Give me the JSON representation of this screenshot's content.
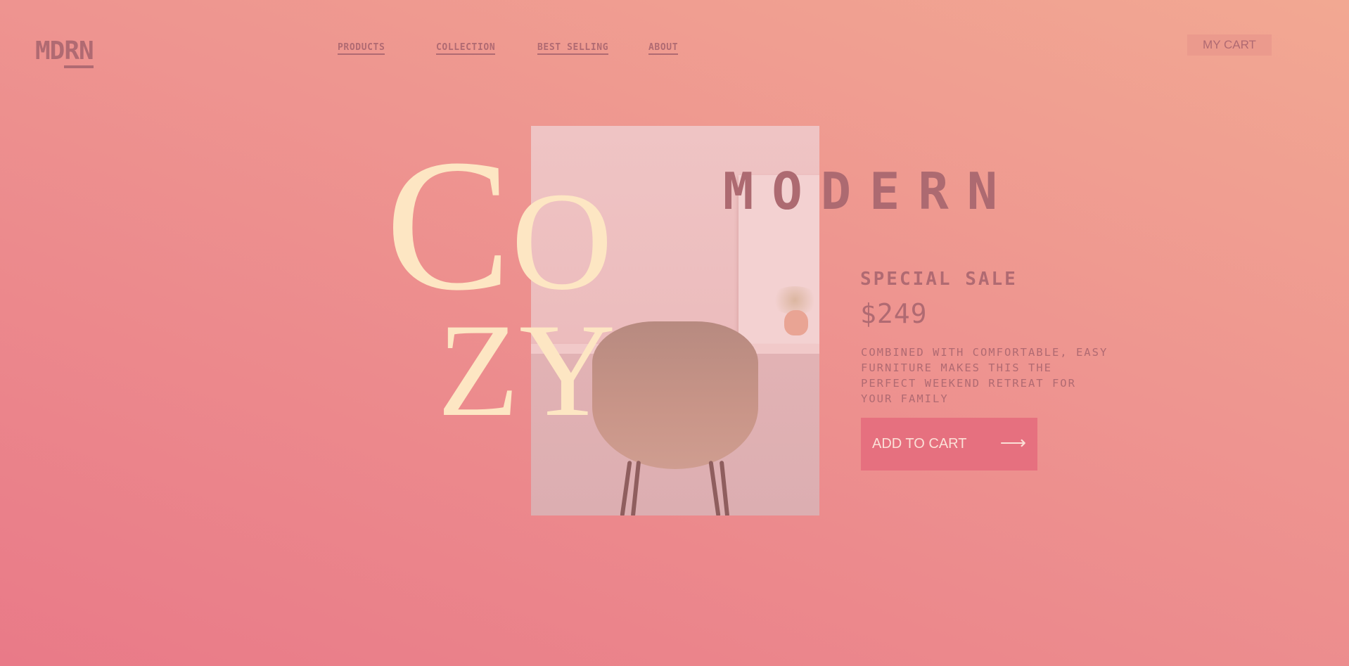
{
  "brand": {
    "logo_prefix": "MD",
    "logo_suffix": "RN"
  },
  "nav": {
    "items": [
      {
        "label": "PRODUCTS"
      },
      {
        "label": "COLLECTION"
      },
      {
        "label": "BEST SELLING"
      },
      {
        "label": "ABOUT"
      }
    ]
  },
  "header": {
    "cart_label": "MY CART"
  },
  "hero": {
    "word_top_c": "C",
    "word_top_o": "O",
    "word_bottom": "ZY",
    "title": "MODERN",
    "photo_icon": "chair-photo"
  },
  "product": {
    "sale_label": "SPECIAL SALE",
    "price": "$249",
    "description": "COMBINED WITH COMFORTABLE, EASY FURNITURE MAKES THIS THE PERFECT WEEKEND RETREAT FOR YOUR FAMILY",
    "cta_label": "ADD TO CART",
    "cta_icon": "arrow-right-icon",
    "cta_arrow": "⟶"
  },
  "colors": {
    "accent": "#e6707f",
    "text": "#b06a72",
    "cream": "#fde6c3"
  }
}
